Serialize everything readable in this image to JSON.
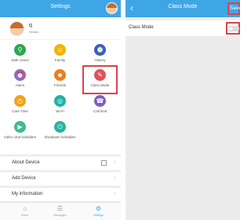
{
  "left": {
    "title": "Settings",
    "profile": {
      "name": "q",
      "sub": "Details"
    },
    "grid": [
      {
        "label": "Safe zones",
        "icon": "map-pin-icon",
        "color": "#2ea84f",
        "glyph": "⚲"
      },
      {
        "label": "Family",
        "icon": "family-icon",
        "color": "#f0b400",
        "glyph": "☺"
      },
      {
        "label": "History",
        "icon": "history-icon",
        "color": "#2f63c7",
        "glyph": "⌚"
      },
      {
        "label": "Alarm",
        "icon": "alarm-icon",
        "color": "#8e6bc9",
        "glyph": "⏰"
      },
      {
        "label": "Friends",
        "icon": "friends-icon",
        "color": "#ef7d1a",
        "glyph": "☻"
      },
      {
        "label": "Class Mode",
        "icon": "class-mode-icon",
        "color": "#e0515a",
        "glyph": "✎"
      },
      {
        "label": "Care Time",
        "icon": "care-time-icon",
        "color": "#f0a21c",
        "glyph": "◷"
      },
      {
        "label": "Wi-Fi",
        "icon": "wifi-icon",
        "color": "#1db3a6",
        "glyph": "◎"
      },
      {
        "label": "Call limit",
        "icon": "call-limit-icon",
        "color": "#7e5ec3",
        "glyph": "☎"
      },
      {
        "label": "Video chat forbidden",
        "icon": "video-chat-icon",
        "color": "#3dbb8e",
        "glyph": "▶"
      },
      {
        "label": "Shutdown forbidden",
        "icon": "shutdown-icon",
        "color": "#28b4a3",
        "glyph": "⏻"
      }
    ],
    "menu": [
      {
        "label": "About Device"
      },
      {
        "label": "Add Device"
      },
      {
        "label": "My information"
      }
    ],
    "tabs": [
      {
        "label": "Home",
        "glyph": "⌂"
      },
      {
        "label": "Messages",
        "glyph": "☰"
      },
      {
        "label": "Settings",
        "glyph": "⚙"
      }
    ]
  },
  "right": {
    "title": "Class Mode",
    "save": "Save",
    "row_label": "Class Mode",
    "toggle_on": false
  },
  "colors": {
    "accent": "#3fa6e6",
    "highlight": "#d9434a"
  }
}
